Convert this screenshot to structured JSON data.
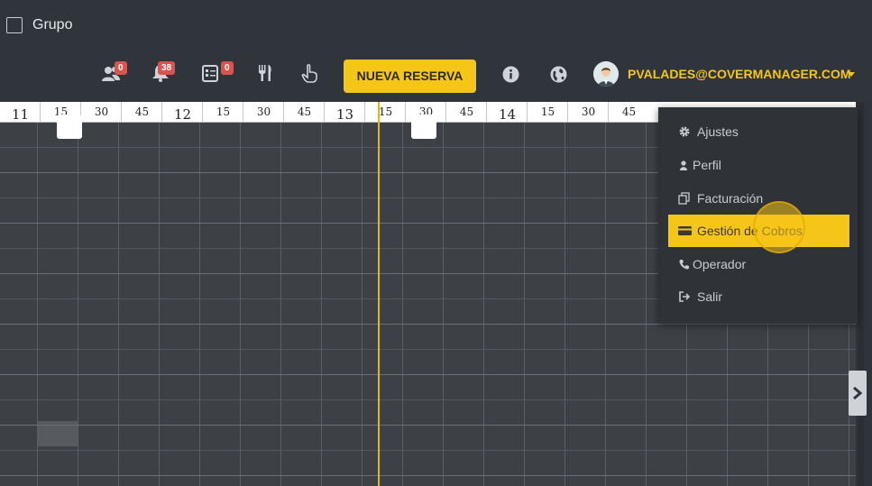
{
  "header": {
    "grupo_label": "Grupo",
    "badges": {
      "clients": "0",
      "notifications": "38",
      "reservations": "0"
    },
    "nueva_reserva_label": "NUEVA RESERVA",
    "user_email": "PVALADES@COVERMANAGER.COM"
  },
  "timeline": {
    "ticks": [
      "11",
      "15",
      "30",
      "45",
      "12",
      "15",
      "30",
      "45",
      "13",
      "15",
      "30",
      "45",
      "14",
      "15",
      "30",
      "45"
    ]
  },
  "user_menu": {
    "items": [
      {
        "label": "Ajustes",
        "icon": "gear-icon"
      },
      {
        "label": "Perfil",
        "icon": "user-icon"
      },
      {
        "label": "Facturación",
        "icon": "invoice-icon"
      },
      {
        "label": "Gestión de Cobros",
        "icon": "credit-card-icon",
        "active": true
      },
      {
        "label": "Operador",
        "icon": "phone-icon"
      },
      {
        "label": "Salir",
        "icon": "logout-icon"
      }
    ]
  },
  "colors": {
    "accent": "#f5c518",
    "badge": "#d9534f",
    "background": "#2f343a",
    "grid": "#3d4146"
  }
}
